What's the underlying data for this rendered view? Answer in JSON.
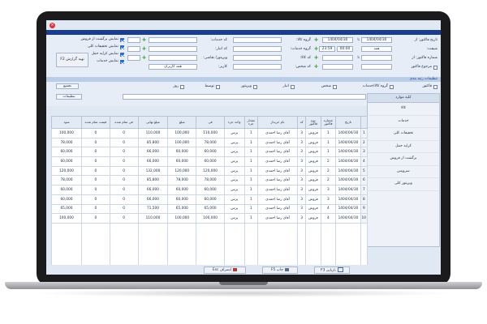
{
  "window": {
    "close_glyph": "×"
  },
  "filters": {
    "invoice_date_from_label": "تاریخ فاکتور: از",
    "date_from": "1404/04/30",
    "to_label": "تا",
    "date_to": "1404/04/30",
    "shift_label": "شیفت:",
    "shift_value": "همه",
    "time_from": "00:00",
    "time_to": "23:59",
    "invoice_no_from_label": "شماره فاکتور: از",
    "invoice_no_to_label": "تا",
    "return_invoices_label": "مرجوع فاکتور",
    "goods_group_label": "گروه کالا:",
    "service_group_label": "گروه خدمات:",
    "goods_code_label": "کد کالا:",
    "person_code_label": "کد شخص:",
    "visitor_label": "ویزیتور/ نقاشی:",
    "services_code_label": "کد خدمات:",
    "user_code_label": "کد انبار:",
    "user_value": "",
    "category_label": "کاربر:",
    "category_value": "همه کاربران",
    "show_returned_label": "نمایش برگشت از فروش",
    "show_discounts_label": "نمایش تخفیفات کلی",
    "show_freight_label": "نمایش کرایه حمل",
    "show_services_label": "نمایش خدمات",
    "report_button": "تهیه گزارش F2"
  },
  "settings_band": {
    "title": "تنظیمات رتبه بندی"
  },
  "filter_row": {
    "invoice": "فاکتور",
    "goods_services": "گروه کالا/خدمات",
    "person": "شخص",
    "warehouse": "انبار",
    "visitor": "ویزیتور",
    "average": "توسط",
    "day": "روز",
    "search_label": "جستجو F12",
    "search_value": "همه موارد",
    "group_button": "تجمیع",
    "settings_button": "تنظیمات"
  },
  "sidepanel": {
    "header": "کلیه موارد",
    "items": [
      "کالا",
      "خدمات",
      "تخفیفات کلی",
      "کرایه حمل",
      "برگشت از فروش",
      "سرویس",
      "ویزیتور کلی"
    ]
  },
  "grid": {
    "columns": [
      "",
      "تاریخ",
      "شماره فاکتور",
      "نوع فاکتور",
      "کد",
      "نام خریدار",
      "مقدار جزء",
      "واحد جزء",
      "فی",
      "مبلغ",
      "مبلغ نهایی",
      "فی تمام شده",
      "قیمت تمام شده",
      "سود"
    ],
    "rows": [
      [
        "1",
        "1404/04/30",
        "1",
        "فروش",
        "3",
        "آقای رضا احمدی",
        "1",
        "پرس",
        "110,000",
        "100,000",
        "110,000",
        "0",
        "0",
        "100,000"
      ],
      [
        "2",
        "1404/04/30",
        "1",
        "فروش",
        "3",
        "آقای رضا احمدی",
        "1",
        "پرس",
        "78,000",
        "100,000",
        "85,800",
        "0",
        "0",
        "78,000"
      ],
      [
        "3",
        "1404/04/30",
        "1",
        "فروش",
        "3",
        "آقای رضا احمدی",
        "1",
        "پرس",
        "60,000",
        "60,000",
        "66,000",
        "0",
        "0",
        "60,000"
      ],
      [
        "4",
        "1404/04/30",
        "2",
        "فروش",
        "3",
        "آقای رضا احمدی",
        "1",
        "پرس",
        "60,000",
        "60,000",
        "66,000",
        "0",
        "0",
        "60,000"
      ],
      [
        "5",
        "1404/04/30",
        "2",
        "فروش",
        "3",
        "آقای رضا احمدی",
        "1",
        "پرس",
        "120,000",
        "120,000",
        "132,000",
        "0",
        "0",
        "120,000"
      ],
      [
        "6",
        "1404/04/30",
        "2",
        "فروش",
        "3",
        "آقای رضا احمدی",
        "1",
        "پرس",
        "78,000",
        "78,000",
        "85,800",
        "0",
        "0",
        "78,000"
      ],
      [
        "7",
        "1404/04/30",
        "3",
        "فروش",
        "3",
        "آقای رضا احمدی",
        "1",
        "پرس",
        "60,000",
        "60,000",
        "66,000",
        "0",
        "0",
        "60,000"
      ],
      [
        "8",
        "1404/04/30",
        "3",
        "فروش",
        "3",
        "آقای رضا احمدی",
        "1",
        "پرس",
        "60,000",
        "60,000",
        "66,000",
        "0",
        "0",
        "60,000"
      ],
      [
        "9",
        "1404/04/30",
        "4",
        "فروش",
        "3",
        "آقای رضا احمدی",
        "1",
        "پرس",
        "65,000",
        "65,000",
        "71,500",
        "0",
        "0",
        "65,000"
      ],
      [
        "10",
        "1404/04/30",
        "4",
        "فروش",
        "3",
        "آقای رضا احمدی",
        "1",
        "پرس",
        "100,000",
        "100,000",
        "110,000",
        "0",
        "0",
        "100,000"
      ]
    ],
    "total": [
      "12",
      "",
      "",
      "",
      "",
      "",
      "13",
      "",
      "",
      "",
      "1,035,100",
      "",
      "0",
      "941,000"
    ]
  },
  "bottom": {
    "reprint": "بازیابی F3",
    "print": "چاپ F5",
    "exit": "انصراف Esc"
  }
}
